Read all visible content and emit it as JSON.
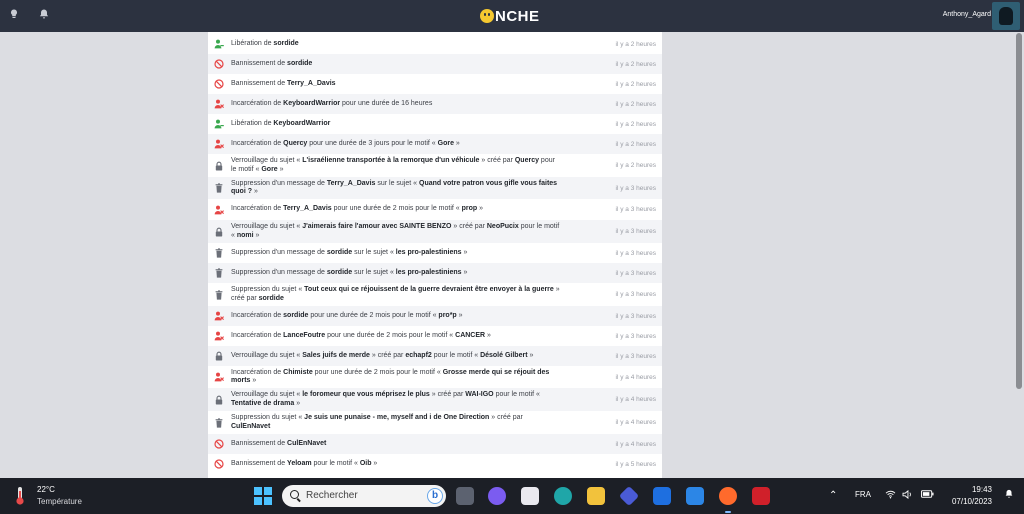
{
  "header": {
    "logo_text": "NCHE",
    "username": "Anthony_Agard"
  },
  "colors": {
    "release": "#3aa84f",
    "jail": "#e64545",
    "ban": "#e64545",
    "lock": "#6b6f78",
    "trash": "#6b6f78"
  },
  "log_entries": [
    {
      "icon": "user-release-icon",
      "parts": [
        [
          "Libération de ",
          0
        ],
        [
          "sordide",
          1
        ]
      ],
      "time": "il y a 2 heures"
    },
    {
      "icon": "ban-icon",
      "parts": [
        [
          "Bannissement de ",
          0
        ],
        [
          "sordide",
          1
        ]
      ],
      "time": "il y a 2 heures"
    },
    {
      "icon": "ban-icon",
      "parts": [
        [
          "Bannissement de ",
          0
        ],
        [
          "Terry_A_Davis",
          1
        ]
      ],
      "time": "il y a 2 heures"
    },
    {
      "icon": "user-jail-icon",
      "parts": [
        [
          "Incarcération de ",
          0
        ],
        [
          "KeyboardWarrior",
          1
        ],
        [
          " pour une durée de 16 heures",
          0
        ]
      ],
      "time": "il y a 2 heures"
    },
    {
      "icon": "user-release-icon",
      "parts": [
        [
          "Libération de ",
          0
        ],
        [
          "KeyboardWarrior",
          1
        ]
      ],
      "time": "il y a 2 heures"
    },
    {
      "icon": "user-jail-icon",
      "parts": [
        [
          "Incarcération de ",
          0
        ],
        [
          "Quercy",
          1
        ],
        [
          " pour une durée de 3 jours pour le motif « ",
          0
        ],
        [
          "Gore",
          1
        ],
        [
          " »",
          0
        ]
      ],
      "time": "il y a 2 heures"
    },
    {
      "icon": "lock-icon",
      "parts": [
        [
          "Verrouillage du sujet « ",
          0
        ],
        [
          "L'israélienne transportée à la remorque d'un véhicule",
          1
        ],
        [
          " » créé par ",
          0
        ],
        [
          "Quercy",
          1
        ],
        [
          " pour le motif « ",
          0
        ],
        [
          "Gore",
          1
        ],
        [
          " »",
          0
        ]
      ],
      "time": "il y a 2 heures"
    },
    {
      "icon": "trash-icon",
      "parts": [
        [
          "Suppression d'un message de ",
          0
        ],
        [
          "Terry_A_Davis",
          1
        ],
        [
          " sur le sujet « ",
          0
        ],
        [
          "Quand votre patron vous gifle vous faites quoi ?",
          1
        ],
        [
          " »",
          0
        ]
      ],
      "time": "il y a 3 heures"
    },
    {
      "icon": "user-jail-icon",
      "parts": [
        [
          "Incarcération de ",
          0
        ],
        [
          "Terry_A_Davis",
          1
        ],
        [
          " pour une durée de 2 mois pour le motif « ",
          0
        ],
        [
          "prop",
          1
        ],
        [
          " »",
          0
        ]
      ],
      "time": "il y a 3 heures"
    },
    {
      "icon": "lock-icon",
      "parts": [
        [
          "Verrouillage du sujet « ",
          0
        ],
        [
          "J'aimerais faire l'amour avec SAINTE BENZO",
          1
        ],
        [
          " » créé par ",
          0
        ],
        [
          "NeoPucix",
          1
        ],
        [
          " pour le motif « ",
          0
        ],
        [
          "nomi",
          1
        ],
        [
          " »",
          0
        ]
      ],
      "time": "il y a 3 heures"
    },
    {
      "icon": "trash-icon",
      "parts": [
        [
          "Suppression d'un message de ",
          0
        ],
        [
          "sordide",
          1
        ],
        [
          " sur le sujet « ",
          0
        ],
        [
          "les pro-palestiniens",
          1
        ],
        [
          " »",
          0
        ]
      ],
      "time": "il y a 3 heures"
    },
    {
      "icon": "trash-icon",
      "parts": [
        [
          "Suppression d'un message de ",
          0
        ],
        [
          "sordide",
          1
        ],
        [
          " sur le sujet « ",
          0
        ],
        [
          "les pro-palestiniens",
          1
        ],
        [
          " »",
          0
        ]
      ],
      "time": "il y a 3 heures"
    },
    {
      "icon": "trash-icon",
      "parts": [
        [
          "Suppression du sujet « ",
          0
        ],
        [
          "Tout ceux qui ce réjouissent de la guerre devraient être envoyer à la guerre",
          1
        ],
        [
          " » créé par ",
          0
        ],
        [
          "sordide",
          1
        ]
      ],
      "time": "il y a 3 heures"
    },
    {
      "icon": "user-jail-icon",
      "parts": [
        [
          "Incarcération de ",
          0
        ],
        [
          "sordide",
          1
        ],
        [
          " pour une durée de 2 mois pour le motif « ",
          0
        ],
        [
          "pro*p",
          1
        ],
        [
          " »",
          0
        ]
      ],
      "time": "il y a 3 heures"
    },
    {
      "icon": "user-jail-icon",
      "parts": [
        [
          "Incarcération de ",
          0
        ],
        [
          "LanceFoutre",
          1
        ],
        [
          " pour une durée de 2 mois pour le motif « ",
          0
        ],
        [
          "CANCER",
          1
        ],
        [
          " »",
          0
        ]
      ],
      "time": "il y a 3 heures"
    },
    {
      "icon": "lock-icon",
      "parts": [
        [
          "Verrouillage du sujet « ",
          0
        ],
        [
          "Sales juifs de merde",
          1
        ],
        [
          " » créé par ",
          0
        ],
        [
          "echapf2",
          1
        ],
        [
          " pour le motif « ",
          0
        ],
        [
          "Désolé Gilbert",
          1
        ],
        [
          " »",
          0
        ]
      ],
      "time": "il y a 3 heures"
    },
    {
      "icon": "user-jail-icon",
      "parts": [
        [
          "Incarcération de ",
          0
        ],
        [
          "Chimiste",
          1
        ],
        [
          " pour une durée de 2 mois pour le motif « ",
          0
        ],
        [
          "Grosse merde qui se réjouit des morts",
          1
        ],
        [
          " »",
          0
        ]
      ],
      "time": "il y a 4 heures"
    },
    {
      "icon": "lock-icon",
      "parts": [
        [
          "Verrouillage du sujet « ",
          0
        ],
        [
          "le foromeur que vous méprisez le plus",
          1
        ],
        [
          " » créé par ",
          0
        ],
        [
          "WAI-IGO",
          1
        ],
        [
          " pour le motif « ",
          0
        ],
        [
          "Tentative de drama",
          1
        ],
        [
          " »",
          0
        ]
      ],
      "time": "il y a 4 heures"
    },
    {
      "icon": "trash-icon",
      "parts": [
        [
          "Suppression du sujet « ",
          0
        ],
        [
          "Je suis une punaise - me, myself and i de One Direction",
          1
        ],
        [
          " » créé par ",
          0
        ],
        [
          "CulEnNavet",
          1
        ]
      ],
      "time": "il y a 4 heures"
    },
    {
      "icon": "ban-icon",
      "parts": [
        [
          "Bannissement de ",
          0
        ],
        [
          "CulEnNavet",
          1
        ]
      ],
      "time": "il y a 4 heures"
    },
    {
      "icon": "ban-icon",
      "parts": [
        [
          "Bannissement de ",
          0
        ],
        [
          "Yeloam",
          1
        ],
        [
          " pour le motif « ",
          0
        ],
        [
          "Oib",
          1
        ],
        [
          " »",
          0
        ]
      ],
      "time": "il y a 5 heures"
    }
  ],
  "taskbar": {
    "weather_temp": "22°C",
    "weather_label": "Température",
    "search_placeholder": "Rechercher",
    "language": "FRA",
    "time": "19:43",
    "date": "07/10/2023",
    "apps": [
      "task-view-icon",
      "chat-icon",
      "store-icon",
      "edge-icon",
      "file-explorer-icon",
      "app-icon",
      "app-icon",
      "mail-icon",
      "firefox-icon",
      "app-icon"
    ]
  }
}
